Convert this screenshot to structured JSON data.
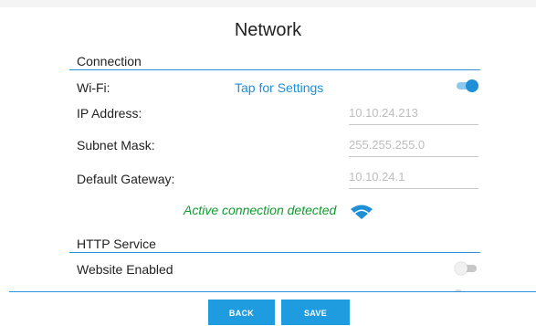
{
  "page": {
    "title": "Network"
  },
  "connection": {
    "section_title": "Connection",
    "wifi": {
      "label": "Wi-Fi:",
      "link_text": "Tap for Settings",
      "enabled": true
    },
    "ip": {
      "label": "IP Address:",
      "value": "10.10.24.213"
    },
    "subnet": {
      "label": "Subnet Mask:",
      "value": "255.255.255.0"
    },
    "gateway": {
      "label": "Default Gateway:",
      "value": "10.10.24.1"
    },
    "status_text": "Active connection detected"
  },
  "http": {
    "section_title": "HTTP Service",
    "website": {
      "label": "Website Enabled",
      "enabled": false
    }
  },
  "buttons": {
    "back": "BACK",
    "save": "SAVE"
  },
  "colors": {
    "accent": "#1f8fd6",
    "status_green": "#0f9d2e",
    "button_blue": "#1f9be0"
  },
  "icons": {
    "wifi": "wifi-icon"
  }
}
